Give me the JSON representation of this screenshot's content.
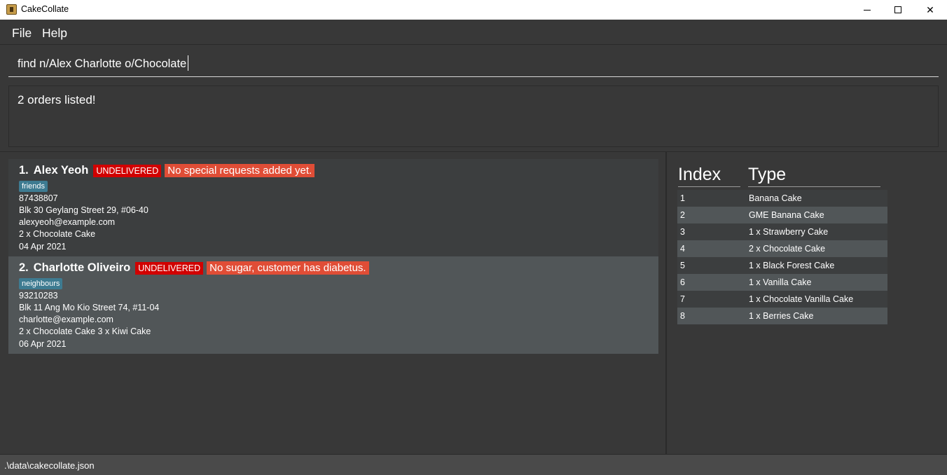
{
  "window": {
    "title": "CakeCollate"
  },
  "menu": {
    "file": "File",
    "help": "Help"
  },
  "command": {
    "value": "find n/Alex Charlotte o/Chocolate"
  },
  "result": {
    "message": "2 orders listed!"
  },
  "orders": [
    {
      "index": "1.",
      "name": "Alex Yeoh",
      "status": "UNDELIVERED",
      "request": "No special requests added yet.",
      "tag": "friends",
      "phone": "87438807",
      "address": "Blk 30 Geylang Street 29, #06-40",
      "email": "alexyeoh@example.com",
      "order": "2 x Chocolate Cake",
      "date": "04 Apr 2021"
    },
    {
      "index": "2.",
      "name": "Charlotte Oliveiro",
      "status": "UNDELIVERED",
      "request": "No sugar, customer has diabetus.",
      "tag": "neighbours",
      "phone": "93210283",
      "address": "Blk 11 Ang Mo Kio Street 74, #11-04",
      "email": "charlotte@example.com",
      "order": "2 x Chocolate Cake 3 x Kiwi Cake",
      "date": "06 Apr 2021"
    }
  ],
  "items_table": {
    "headers": {
      "index": "Index",
      "type": "Type"
    },
    "rows": [
      {
        "index": "1",
        "type": "Banana Cake"
      },
      {
        "index": "2",
        "type": "GME Banana Cake"
      },
      {
        "index": "3",
        "type": "1 x Strawberry Cake"
      },
      {
        "index": "4",
        "type": "2 x Chocolate Cake"
      },
      {
        "index": "5",
        "type": "1 x Black Forest Cake"
      },
      {
        "index": "6",
        "type": "1 x Vanilla Cake"
      },
      {
        "index": "7",
        "type": "1 x Chocolate Vanilla Cake"
      },
      {
        "index": "8",
        "type": "1 x Berries Cake"
      }
    ]
  },
  "status_bar": {
    "path": ".\\data\\cakecollate.json"
  },
  "colors": {
    "undelivered": "#d10000",
    "request": "#e04d36",
    "tag": "#3e7b91"
  }
}
